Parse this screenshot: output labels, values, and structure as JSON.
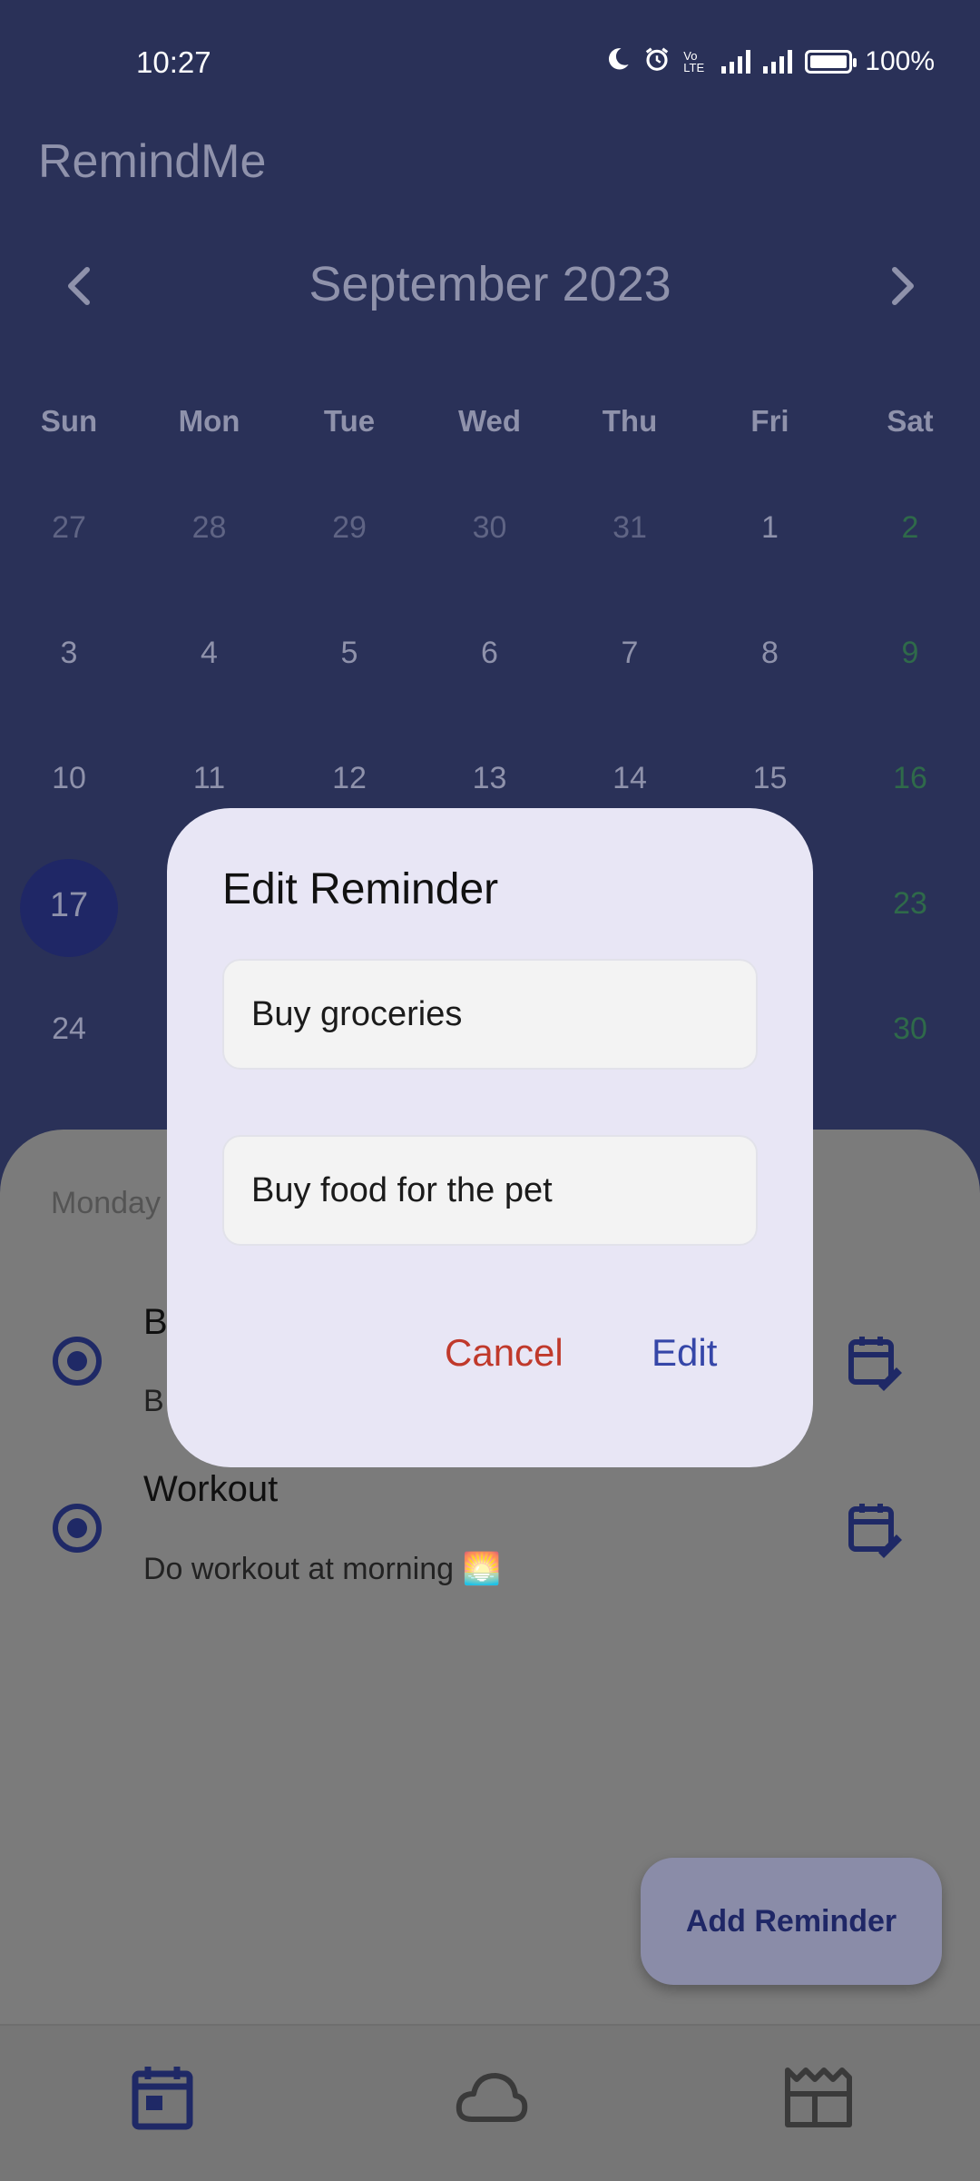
{
  "status_bar": {
    "time": "10:27",
    "battery": "100%",
    "icons": [
      "moon-icon",
      "alarm-icon",
      "volte-icon",
      "signal-icon",
      "signal-icon",
      "battery-icon"
    ],
    "volte_label": "Vo LTE"
  },
  "app": {
    "title": "RemindMe"
  },
  "calendar": {
    "month_label": "September 2023",
    "weekdays": [
      "Sun",
      "Mon",
      "Tue",
      "Wed",
      "Thu",
      "Fri",
      "Sat"
    ],
    "rows": [
      [
        "27",
        "28",
        "29",
        "30",
        "31",
        "1",
        "2"
      ],
      [
        "3",
        "4",
        "5",
        "6",
        "7",
        "8",
        "9"
      ],
      [
        "10",
        "11",
        "12",
        "13",
        "14",
        "15",
        "16"
      ],
      [
        "17",
        "",
        "",
        "",
        "",
        "",
        "23"
      ],
      [
        "24",
        "",
        "",
        "",
        "",
        "",
        "30"
      ]
    ],
    "selected_day": "17"
  },
  "sheet": {
    "date_partial": "Monday",
    "reminders": [
      {
        "title_partial": "B",
        "subtitle_partial": "B"
      },
      {
        "title": "Workout",
        "subtitle": "Do workout at morning 🌅"
      }
    ]
  },
  "fab": {
    "label": "Add Reminder"
  },
  "bottom_nav": {
    "items": [
      "calendar-icon",
      "cloud-icon",
      "news-icon"
    ]
  },
  "dialog": {
    "title": "Edit Reminder",
    "title_value": "Buy groceries",
    "description_value": "Buy food for the pet",
    "cancel_label": "Cancel",
    "edit_label": "Edit"
  },
  "colors": {
    "primary": "#3546a8",
    "cancel": "#c0392b",
    "dialog_bg": "#e8e6f5",
    "top_bg_dimmed": "#2a3158",
    "weekend": "#2f6a4a"
  }
}
